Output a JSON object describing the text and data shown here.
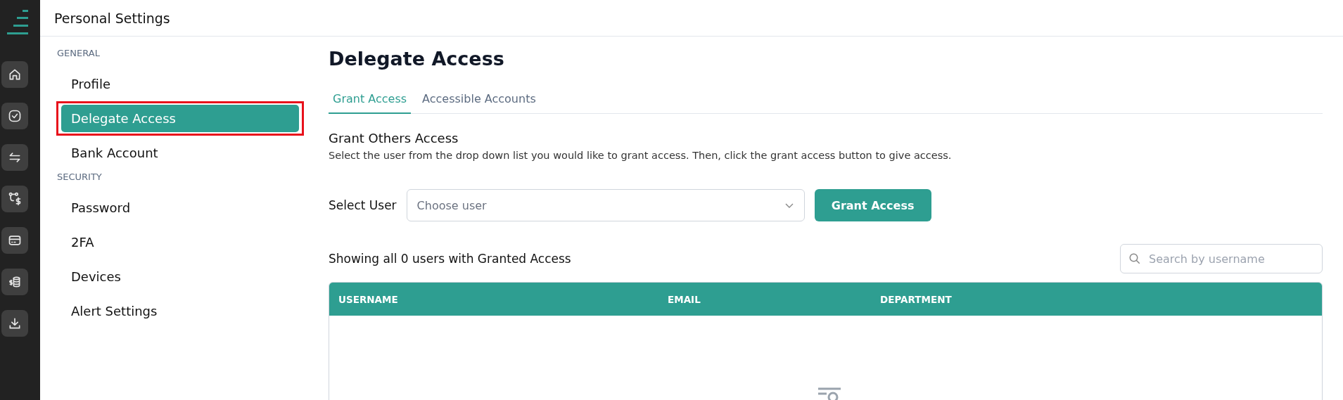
{
  "header": {
    "title": "Personal Settings"
  },
  "rail": {
    "items": [
      {
        "kind": "home"
      },
      {
        "kind": "check"
      },
      {
        "kind": "transfer"
      },
      {
        "kind": "flow"
      },
      {
        "kind": "card"
      },
      {
        "kind": "coins"
      },
      {
        "kind": "download"
      }
    ]
  },
  "sidebar": {
    "sections": [
      {
        "heading": "GENERAL",
        "items": [
          {
            "label": "Profile",
            "selected": false,
            "highlighted": false
          },
          {
            "label": "Delegate Access",
            "selected": true,
            "highlighted": true
          },
          {
            "label": "Bank Account",
            "selected": false,
            "highlighted": false
          }
        ]
      },
      {
        "heading": "SECURITY",
        "items": [
          {
            "label": "Password",
            "selected": false,
            "highlighted": false
          },
          {
            "label": "2FA",
            "selected": false,
            "highlighted": false
          },
          {
            "label": "Devices",
            "selected": false,
            "highlighted": false
          },
          {
            "label": "Alert Settings",
            "selected": false,
            "highlighted": false
          }
        ]
      }
    ]
  },
  "page": {
    "title": "Delegate Access",
    "tabs": [
      {
        "label": "Grant Access",
        "selected": true
      },
      {
        "label": "Accessible Accounts",
        "selected": false
      }
    ],
    "section": {
      "heading": "Grant Others Access",
      "description": "Select the user from the drop down list you would like to grant access. Then, click the grant access button to give access."
    },
    "select_user": {
      "label": "Select User",
      "placeholder": "Choose user"
    },
    "grant_button": "Grant Access",
    "summary": "Showing all 0 users with Granted Access",
    "search": {
      "placeholder": "Search by username"
    },
    "table": {
      "columns": [
        "USERNAME",
        "EMAIL",
        "DEPARTMENT"
      ]
    }
  }
}
